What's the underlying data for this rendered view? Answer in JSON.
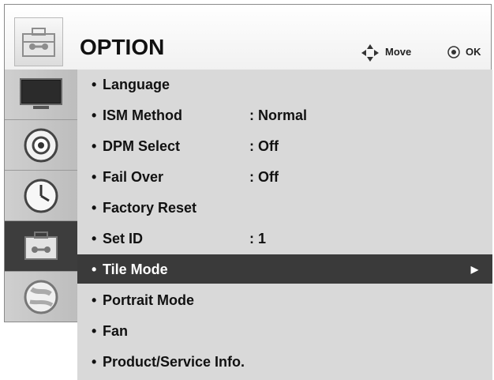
{
  "header": {
    "title": "OPTION",
    "move_label": "Move",
    "ok_label": "OK",
    "icon": "toolbox-icon"
  },
  "sidebar": {
    "items": [
      {
        "name": "picture",
        "icon": "tv-icon",
        "active": false
      },
      {
        "name": "audio",
        "icon": "speaker-icon",
        "active": false
      },
      {
        "name": "time",
        "icon": "clock-icon",
        "active": false
      },
      {
        "name": "option",
        "icon": "toolbox-icon",
        "active": true
      },
      {
        "name": "network",
        "icon": "globe-icon",
        "active": false
      }
    ]
  },
  "menu": {
    "bullet": "•",
    "items": [
      {
        "label": "Language",
        "value": ""
      },
      {
        "label": "ISM Method",
        "value": ": Normal"
      },
      {
        "label": "DPM Select",
        "value": ": Off"
      },
      {
        "label": "Fail Over",
        "value": ": Off"
      },
      {
        "label": "Factory Reset",
        "value": ""
      },
      {
        "label": "Set ID",
        "value": ": 1"
      },
      {
        "label": "Tile Mode",
        "value": "",
        "selected": true,
        "submenu_arrow": "▶"
      },
      {
        "label": "Portrait Mode",
        "value": ""
      },
      {
        "label": "Fan",
        "value": ""
      },
      {
        "label": "Product/Service Info.",
        "value": ""
      }
    ]
  },
  "colors": {
    "selected_row": "#3a3a3a",
    "menu_bg": "#d9d9d9",
    "sidebar_active": "#3d3d3d"
  }
}
